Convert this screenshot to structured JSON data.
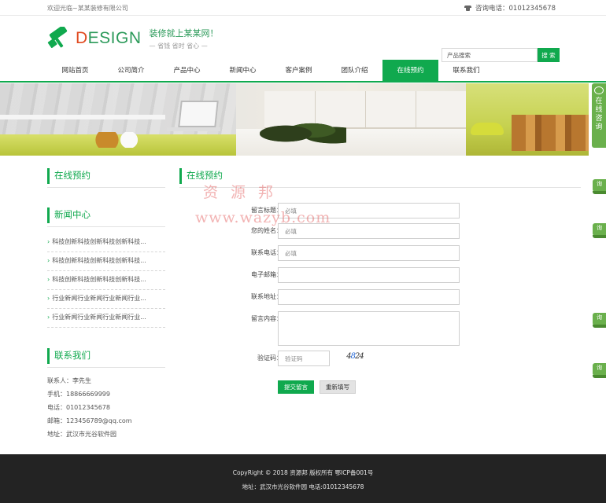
{
  "topbar": {
    "welcome": "欢迎光临~某某装修有限公司",
    "phone_label": "咨询电话：01012345678"
  },
  "header": {
    "logo_text_d": "D",
    "logo_text_rest": "ESIGN",
    "slogan_main": "装修就上某某网！",
    "slogan_sub": "— 省钱  省时  省心 —",
    "search_placeholder": "产品搜索",
    "search_button": "搜 索"
  },
  "nav": {
    "items": [
      "网站首页",
      "公司简介",
      "产品中心",
      "新闻中心",
      "客户案例",
      "团队介绍",
      "在线预约",
      "联系我们"
    ],
    "active_index": 6
  },
  "side_tab": {
    "text": "在线咨询"
  },
  "float_tabs": [
    "询",
    "询",
    "询",
    "询"
  ],
  "sidebar": {
    "booking_title": "在线预约",
    "news_title": "新闻中心",
    "news": [
      "科技创新科技创新科技创新科技...",
      "科技创新科技创新科技创新科技...",
      "科技创新科技创新科技创新科技...",
      "行业新闻行业新闻行业新闻行业...",
      "行业新闻行业新闻行业新闻行业..."
    ],
    "contact_title": "联系我们",
    "contact": {
      "person": "联系人：李先生",
      "mobile": "手机：18866669999",
      "tel": "电话：01012345678",
      "email": "邮箱：123456789@qq.com",
      "address": "地址：武汉市光谷软件园"
    }
  },
  "main": {
    "title": "在线预约",
    "form": {
      "subject_label": "留言标题：",
      "subject_placeholder": "必填",
      "name_label": "您的姓名：",
      "name_placeholder": "必填",
      "phone_label": "联系电话：",
      "phone_placeholder": "必填",
      "email_label": "电子邮箱：",
      "address_label": "联系地址：",
      "content_label": "留言内容：",
      "captcha_label": "验证码：",
      "captcha_placeholder": "验证码",
      "captcha_code_a": "4",
      "captcha_code_b": "8",
      "captcha_code_c": "24",
      "submit": "提交留言",
      "reset": "重新填写"
    }
  },
  "watermark": {
    "line1": "资源邦",
    "line2": "www.wazyb.com"
  },
  "footer": {
    "copyright": "CopyRight © 2018 资源邦 版权所有  鄂ICP备001号",
    "address": "地址：武汉市光谷软件园  电话:01012345678"
  },
  "colors": {
    "brand_green": "#10a94e",
    "logo_orange": "#e04a1f",
    "footer_bg": "#232323"
  }
}
